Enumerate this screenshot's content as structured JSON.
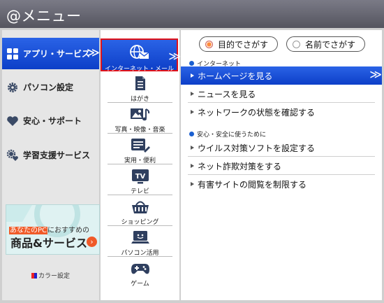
{
  "window": {
    "title": "@メニュー"
  },
  "sidebar": {
    "items": [
      {
        "label": "アプリ・サービス",
        "icon": "grid-icon",
        "active": true
      },
      {
        "label": "パソコン設定",
        "icon": "gear-icon",
        "active": false
      },
      {
        "label": "安心・サポート",
        "icon": "heart-icon",
        "active": false
      },
      {
        "label": "学習支援サービス",
        "icon": "gear-heart-icon",
        "active": false
      }
    ],
    "chevron": "≫",
    "banner": {
      "line1_highlight": "あなたのPC",
      "line1_rest": "におすすめの",
      "line2": "商品&サービス",
      "go": "›"
    },
    "color_setting": "カラー設定"
  },
  "categories": {
    "items": [
      {
        "label": "インターネット・メール",
        "icon": "globe-mail-icon",
        "active": true
      },
      {
        "label": "はがき",
        "icon": "postcard-icon",
        "active": false
      },
      {
        "label": "写真・映像・音楽",
        "icon": "photo-music-icon",
        "active": false
      },
      {
        "label": "実用・便利",
        "icon": "utility-icon",
        "active": false
      },
      {
        "label": "テレビ",
        "icon": "tv-icon",
        "active": false
      },
      {
        "label": "ショッピング",
        "icon": "shopping-basket-icon",
        "active": false
      },
      {
        "label": "パソコン活用",
        "icon": "pc-user-icon",
        "active": false
      },
      {
        "label": "ゲーム",
        "icon": "gamepad-icon",
        "active": false
      }
    ]
  },
  "content": {
    "mode": {
      "purpose_label": "目的でさがす",
      "name_label": "名前でさがす",
      "selected": "purpose"
    },
    "sections": [
      {
        "title": "インターネット",
        "links": [
          {
            "label": "ホームページを見る",
            "active": true
          },
          {
            "label": "ニュースを見る",
            "active": false
          },
          {
            "label": "ネットワークの状態を確認する",
            "active": false
          }
        ]
      },
      {
        "title": "安心・安全に使うために",
        "links": [
          {
            "label": "ウイルス対策ソフトを設定する",
            "active": false
          },
          {
            "label": "ネット詐欺対策をする",
            "active": false
          },
          {
            "label": "有害サイトの閲覧を制限する",
            "active": false
          }
        ]
      }
    ]
  },
  "colors": {
    "accent_blue": "#1a4fd8",
    "highlight_red": "#e0121a",
    "orange": "#f05a28"
  }
}
